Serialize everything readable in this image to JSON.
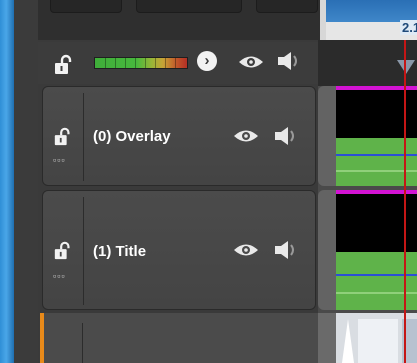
{
  "ruler": {
    "time_label": "2.1"
  },
  "master": {
    "lock_icon": "unlock-icon",
    "level_meter": "vu-meter",
    "expand_button_glyph": "›",
    "eye_icon": "eye-icon",
    "speaker_icon": "speaker-icon"
  },
  "tracks": [
    {
      "name": "(0) Overlay",
      "dots": "▫▫▫"
    },
    {
      "name": "(1) Title",
      "dots": "▫▫▫"
    }
  ],
  "colors": {
    "accent_blue": "#2f8fd6",
    "clip_border_magenta": "#d313d3",
    "playhead_red": "#c41616",
    "audio_green": "#5fb34a",
    "selected_track_orange": "#e88a1a"
  }
}
